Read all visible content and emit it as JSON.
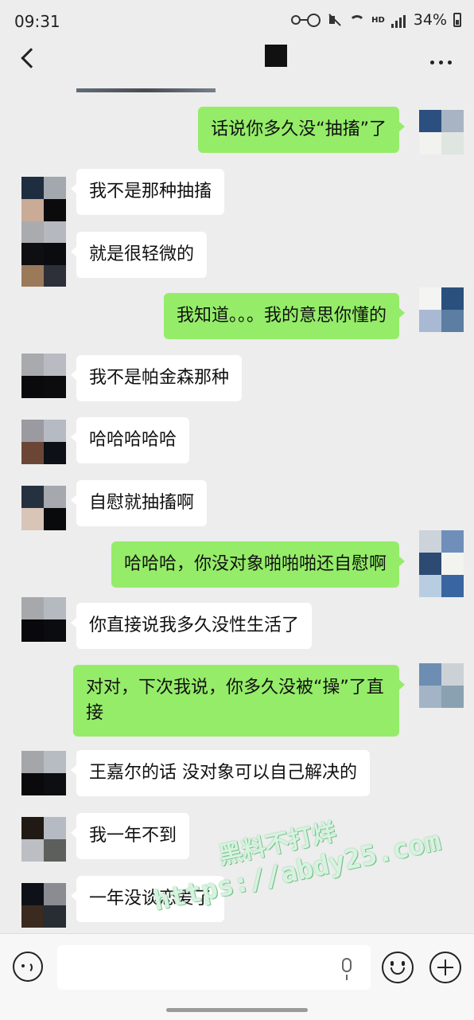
{
  "status_bar": {
    "time": "09:31",
    "network": "HD",
    "battery": "34%"
  },
  "header": {
    "back_icon": "chevron-left-icon",
    "more_icon": "more-dots-icon"
  },
  "messages": [
    {
      "side": "out",
      "text": "话说你多久没“抽搐”了"
    },
    {
      "side": "in",
      "text": "我不是那种抽搐"
    },
    {
      "side": "in",
      "text": "就是很轻微的"
    },
    {
      "side": "out",
      "text": "我知道。。。我的意思你懂的"
    },
    {
      "side": "in",
      "text": "我不是帕金森那种"
    },
    {
      "side": "in",
      "text": "哈哈哈哈哈"
    },
    {
      "side": "in",
      "text": "自慰就抽搐啊"
    },
    {
      "side": "out",
      "text": "哈哈哈，你没对象啪啪啪还自慰啊"
    },
    {
      "side": "in",
      "text": "你直接说我多久没性生活了"
    },
    {
      "side": "out",
      "text": "对对，下次我说，你多久没被“操”了直接"
    },
    {
      "side": "in",
      "text": "王嘉尔的话 没对象可以自己解决的"
    },
    {
      "side": "in",
      "text": "我一年不到"
    },
    {
      "side": "in",
      "text": "一年没谈恋爱了"
    }
  ],
  "input_bar": {
    "voice_icon": "voice-icon",
    "mic_icon": "mic-icon",
    "emoji_icon": "emoji-icon",
    "plus_icon": "plus-icon",
    "input_value": ""
  },
  "watermark": {
    "line1": "黑料不打烊",
    "line2": "https://abdy25.com"
  },
  "colors": {
    "outgoing_bubble": "#95ec69",
    "incoming_bubble": "#ffffff",
    "background": "#ededed"
  }
}
